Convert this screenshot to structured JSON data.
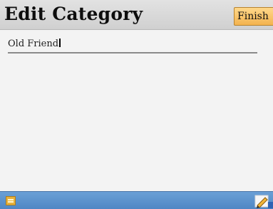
{
  "header": {
    "title": "Edit Category",
    "finish_label": "Finish"
  },
  "form": {
    "category_name_value": "Old Friend"
  },
  "footer": {
    "left_icon": "folder-icon",
    "right_icon": "pencil-edit-icon"
  },
  "colors": {
    "header_bg": "#d7d7d7",
    "finish_button": "#f5bb5a",
    "footer_bg": "#5b8fcc",
    "body_bg": "#f3f3f3"
  }
}
